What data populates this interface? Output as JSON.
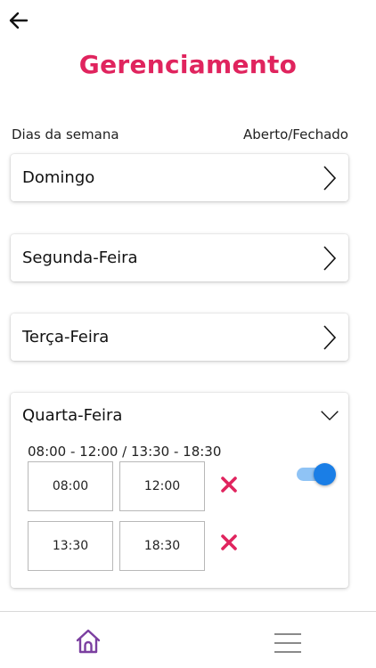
{
  "header": {
    "title": "Gerenciamento",
    "back_icon": "arrow-left-icon"
  },
  "columns": {
    "left": "Dias da semana",
    "right": "Aberto/Fechado"
  },
  "days": [
    {
      "name": "Domingo",
      "expanded": false
    },
    {
      "name": "Segunda-Feira",
      "expanded": false
    },
    {
      "name": "Terça-Feira",
      "expanded": false
    },
    {
      "name": "Quarta-Feira",
      "expanded": true
    }
  ],
  "wednesday": {
    "summary": "08:00 - 12:00 / 13:30 - 18:30",
    "open": true,
    "slots": [
      {
        "start": "08:00",
        "end": "12:00"
      },
      {
        "start": "13:30",
        "end": "18:30"
      }
    ]
  },
  "nav": {
    "home_icon": "home-icon",
    "menu_icon": "hamburger-menu-icon"
  },
  "colors": {
    "accent": "#e0245e",
    "toggle_on": "#1a7ee6",
    "toggle_track": "#8fc3f5",
    "home_icon": "#7b3fa0"
  }
}
